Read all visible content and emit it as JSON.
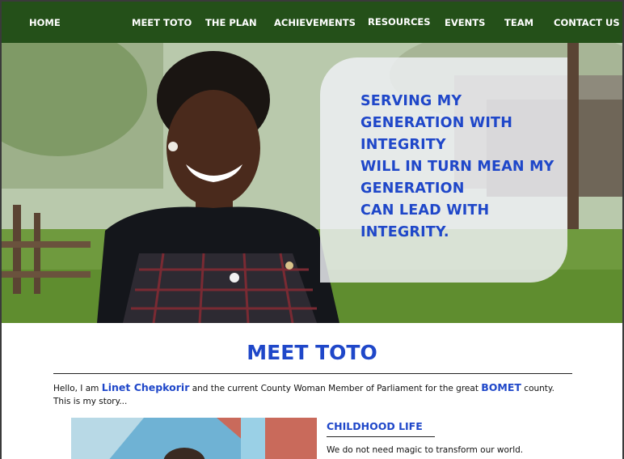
{
  "nav": {
    "items": [
      {
        "label": "HOME"
      },
      {
        "label": "MEET TOTO"
      },
      {
        "label": "THE PLAN"
      },
      {
        "label": "ACHIEVEMENTS"
      },
      {
        "label": "RESOURCES"
      },
      {
        "label": "EVENTS"
      },
      {
        "label": "TEAM"
      },
      {
        "label": "CONTACT US"
      }
    ]
  },
  "hero": {
    "quote_lines": [
      "SERVING MY",
      "GENERATION WITH",
      "INTEGRITY",
      "WILL IN TURN MEAN MY",
      "GENERATION",
      "CAN LEAD WITH",
      "INTEGRITY."
    ]
  },
  "meet": {
    "title": "MEET TOTO",
    "intro_prefix": "Hello, I am ",
    "intro_name": "Linet Chepkorir",
    "intro_middle": " and the current County Woman Member of Parliament for the great ",
    "intro_county": "BOMET",
    "intro_suffix": " county.",
    "intro_line2": "This is my story...",
    "childhood_title": "CHILDHOOD LIFE",
    "childhood_text": "We do not need magic to transform our world."
  },
  "colors": {
    "nav_bg": "#245019",
    "accent_blue": "#1f47c9"
  }
}
